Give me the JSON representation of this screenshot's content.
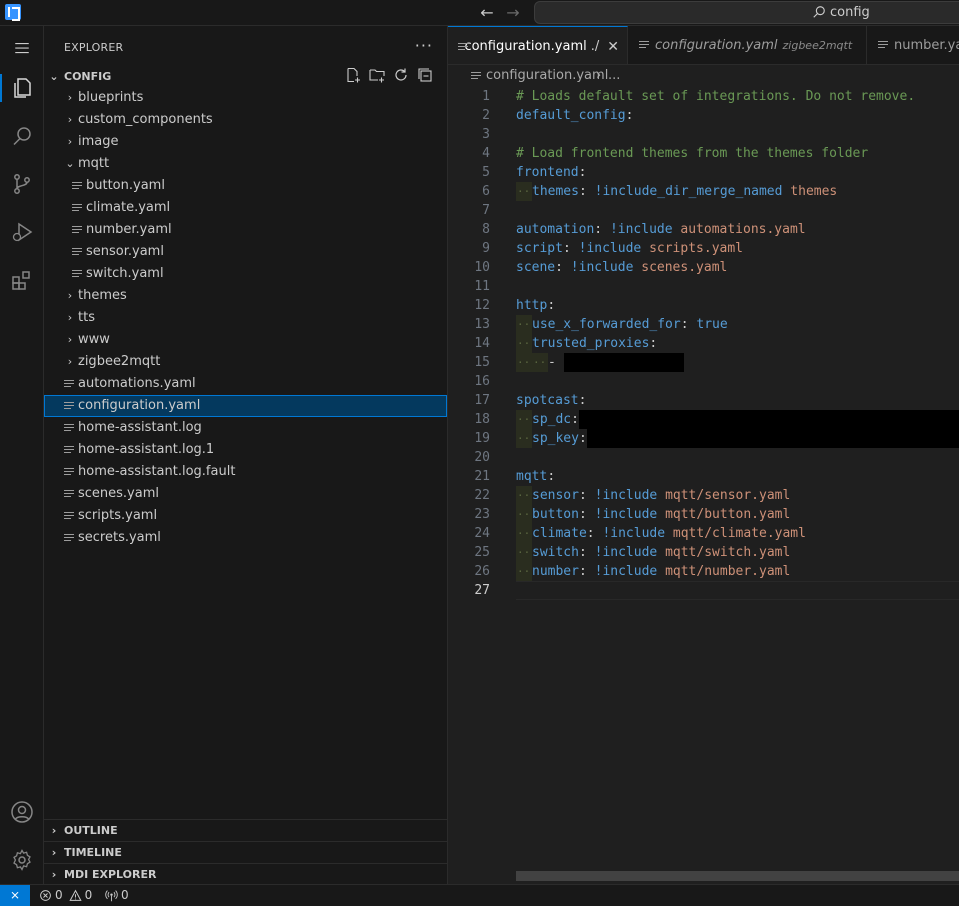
{
  "titlebar": {
    "search_text": "config"
  },
  "sidebar": {
    "title": "EXPLORER",
    "more": "···",
    "root_label": "CONFIG",
    "tree": [
      {
        "label": "blueprints",
        "type": "folder",
        "expanded": false,
        "depth": 1
      },
      {
        "label": "custom_components",
        "type": "folder",
        "expanded": false,
        "depth": 1
      },
      {
        "label": "image",
        "type": "folder",
        "expanded": false,
        "depth": 1
      },
      {
        "label": "mqtt",
        "type": "folder",
        "expanded": true,
        "depth": 1
      },
      {
        "label": "button.yaml",
        "type": "file",
        "depth": 2
      },
      {
        "label": "climate.yaml",
        "type": "file",
        "depth": 2
      },
      {
        "label": "number.yaml",
        "type": "file",
        "depth": 2
      },
      {
        "label": "sensor.yaml",
        "type": "file",
        "depth": 2
      },
      {
        "label": "switch.yaml",
        "type": "file",
        "depth": 2
      },
      {
        "label": "themes",
        "type": "folder",
        "expanded": false,
        "depth": 1
      },
      {
        "label": "tts",
        "type": "folder",
        "expanded": false,
        "depth": 1
      },
      {
        "label": "www",
        "type": "folder",
        "expanded": false,
        "depth": 1
      },
      {
        "label": "zigbee2mqtt",
        "type": "folder",
        "expanded": false,
        "depth": 1
      },
      {
        "label": "automations.yaml",
        "type": "file",
        "depth": 1
      },
      {
        "label": "configuration.yaml",
        "type": "file",
        "depth": 1,
        "selected": true
      },
      {
        "label": "home-assistant.log",
        "type": "file",
        "depth": 1
      },
      {
        "label": "home-assistant.log.1",
        "type": "file",
        "depth": 1
      },
      {
        "label": "home-assistant.log.fault",
        "type": "file",
        "depth": 1
      },
      {
        "label": "scenes.yaml",
        "type": "file",
        "depth": 1
      },
      {
        "label": "scripts.yaml",
        "type": "file",
        "depth": 1
      },
      {
        "label": "secrets.yaml",
        "type": "file",
        "depth": 1
      }
    ],
    "bottom_sections": [
      "OUTLINE",
      "TIMELINE",
      "MDI EXPLORER"
    ]
  },
  "tabs": [
    {
      "label": "configuration.yaml",
      "suffix": "./",
      "active": true,
      "italic": false
    },
    {
      "label": "configuration.yaml",
      "desc": "zigbee2mqtt",
      "active": false,
      "italic": true
    },
    {
      "label": "number.yaml",
      "active": false,
      "italic": false
    }
  ],
  "breadcrumb": {
    "file": "configuration.yaml",
    "sep": "›",
    "more": "..."
  },
  "editor": {
    "current_line": 27,
    "lines": [
      [
        {
          "t": "# Loads default set of integrations. Do not remove.",
          "c": "c-comment"
        }
      ],
      [
        {
          "t": "default_config",
          "c": "c-key"
        },
        {
          "t": ":",
          "c": "c-punc"
        }
      ],
      [],
      [
        {
          "t": "# Load frontend themes from the themes folder",
          "c": "c-comment"
        }
      ],
      [
        {
          "t": "frontend",
          "c": "c-key"
        },
        {
          "t": ":",
          "c": "c-punc"
        }
      ],
      [
        {
          "indent": 1
        },
        {
          "t": "themes",
          "c": "c-key"
        },
        {
          "t": ": ",
          "c": "c-punc"
        },
        {
          "t": "!include_dir_merge_named",
          "c": "c-tag"
        },
        {
          "t": " themes",
          "c": "c-str"
        }
      ],
      [],
      [
        {
          "t": "automation",
          "c": "c-key"
        },
        {
          "t": ": ",
          "c": "c-punc"
        },
        {
          "t": "!include",
          "c": "c-tag"
        },
        {
          "t": " automations.yaml",
          "c": "c-str"
        }
      ],
      [
        {
          "t": "script",
          "c": "c-key"
        },
        {
          "t": ": ",
          "c": "c-punc"
        },
        {
          "t": "!include",
          "c": "c-tag"
        },
        {
          "t": " scripts.yaml",
          "c": "c-str"
        }
      ],
      [
        {
          "t": "scene",
          "c": "c-key"
        },
        {
          "t": ": ",
          "c": "c-punc"
        },
        {
          "t": "!include",
          "c": "c-tag"
        },
        {
          "t": " scenes.yaml",
          "c": "c-str"
        }
      ],
      [],
      [
        {
          "t": "http",
          "c": "c-key"
        },
        {
          "t": ":",
          "c": "c-punc"
        }
      ],
      [
        {
          "indent": 1
        },
        {
          "t": "use_x_forwarded_for",
          "c": "c-key"
        },
        {
          "t": ": ",
          "c": "c-punc"
        },
        {
          "t": "true",
          "c": "c-tag"
        }
      ],
      [
        {
          "indent": 1
        },
        {
          "t": "trusted_proxies",
          "c": "c-key"
        },
        {
          "t": ":",
          "c": "c-punc"
        }
      ],
      [
        {
          "indent": 2
        },
        {
          "t": "- ",
          "c": "c-punc"
        },
        {
          "redact": true
        }
      ],
      [],
      [
        {
          "t": "spotcast",
          "c": "c-key"
        },
        {
          "t": ":",
          "c": "c-punc"
        }
      ],
      [
        {
          "indent": 1
        },
        {
          "t": "sp_dc",
          "c": "c-key"
        },
        {
          "t": ":",
          "c": "c-punc"
        },
        {
          "redact": true
        }
      ],
      [
        {
          "indent": 1
        },
        {
          "t": "sp_key",
          "c": "c-key"
        },
        {
          "t": ":",
          "c": "c-punc"
        },
        {
          "redact": true
        }
      ],
      [],
      [
        {
          "t": "mqtt",
          "c": "c-key"
        },
        {
          "t": ":",
          "c": "c-punc"
        }
      ],
      [
        {
          "indent": 1
        },
        {
          "t": "sensor",
          "c": "c-key"
        },
        {
          "t": ": ",
          "c": "c-punc"
        },
        {
          "t": "!include",
          "c": "c-tag"
        },
        {
          "t": " mqtt/sensor.yaml",
          "c": "c-str"
        }
      ],
      [
        {
          "indent": 1
        },
        {
          "t": "button",
          "c": "c-key"
        },
        {
          "t": ": ",
          "c": "c-punc"
        },
        {
          "t": "!include",
          "c": "c-tag"
        },
        {
          "t": " mqtt/button.yaml",
          "c": "c-str"
        }
      ],
      [
        {
          "indent": 1
        },
        {
          "t": "climate",
          "c": "c-key"
        },
        {
          "t": ": ",
          "c": "c-punc"
        },
        {
          "t": "!include",
          "c": "c-tag"
        },
        {
          "t": " mqtt/climate.yaml",
          "c": "c-str"
        }
      ],
      [
        {
          "indent": 1
        },
        {
          "t": "switch",
          "c": "c-key"
        },
        {
          "t": ": ",
          "c": "c-punc"
        },
        {
          "t": "!include",
          "c": "c-tag"
        },
        {
          "t": " mqtt/switch.yaml",
          "c": "c-str"
        }
      ],
      [
        {
          "indent": 1
        },
        {
          "t": "number",
          "c": "c-key"
        },
        {
          "t": ": ",
          "c": "c-punc"
        },
        {
          "t": "!include",
          "c": "c-tag"
        },
        {
          "t": " mqtt/number.yaml",
          "c": "c-str"
        }
      ],
      []
    ]
  },
  "statusbar": {
    "remote_icon": "remote-icon",
    "errors": "0",
    "warnings": "0",
    "ports": "0"
  }
}
